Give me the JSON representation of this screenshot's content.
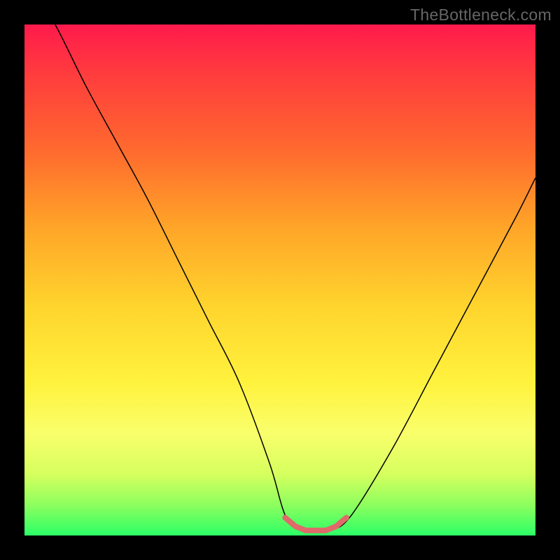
{
  "watermark": "TheBottleneck.com",
  "chart_data": {
    "type": "line",
    "title": "",
    "xlabel": "",
    "ylabel": "",
    "xlim": [
      0,
      100
    ],
    "ylim": [
      0,
      100
    ],
    "series": [
      {
        "name": "bottleneck-curve",
        "x": [
          0,
          6,
          12,
          18,
          24,
          30,
          36,
          42,
          48,
          51,
          54,
          57,
          60,
          64,
          72,
          80,
          88,
          96,
          100
        ],
        "values": [
          110,
          100,
          88,
          77,
          66,
          54,
          42,
          30,
          14,
          4,
          1,
          1,
          1,
          4,
          17,
          32,
          47,
          62,
          70
        ]
      },
      {
        "name": "optimal-band",
        "x": [
          51,
          53,
          55,
          57,
          59,
          61,
          63
        ],
        "values": [
          3.5,
          1.8,
          1,
          1,
          1,
          1.8,
          3.5
        ]
      }
    ],
    "colors": {
      "curve": "#000000",
      "band": "#e06a6a",
      "gradient_top": "#ff1a4c",
      "gradient_bottom": "#2bff66"
    }
  }
}
